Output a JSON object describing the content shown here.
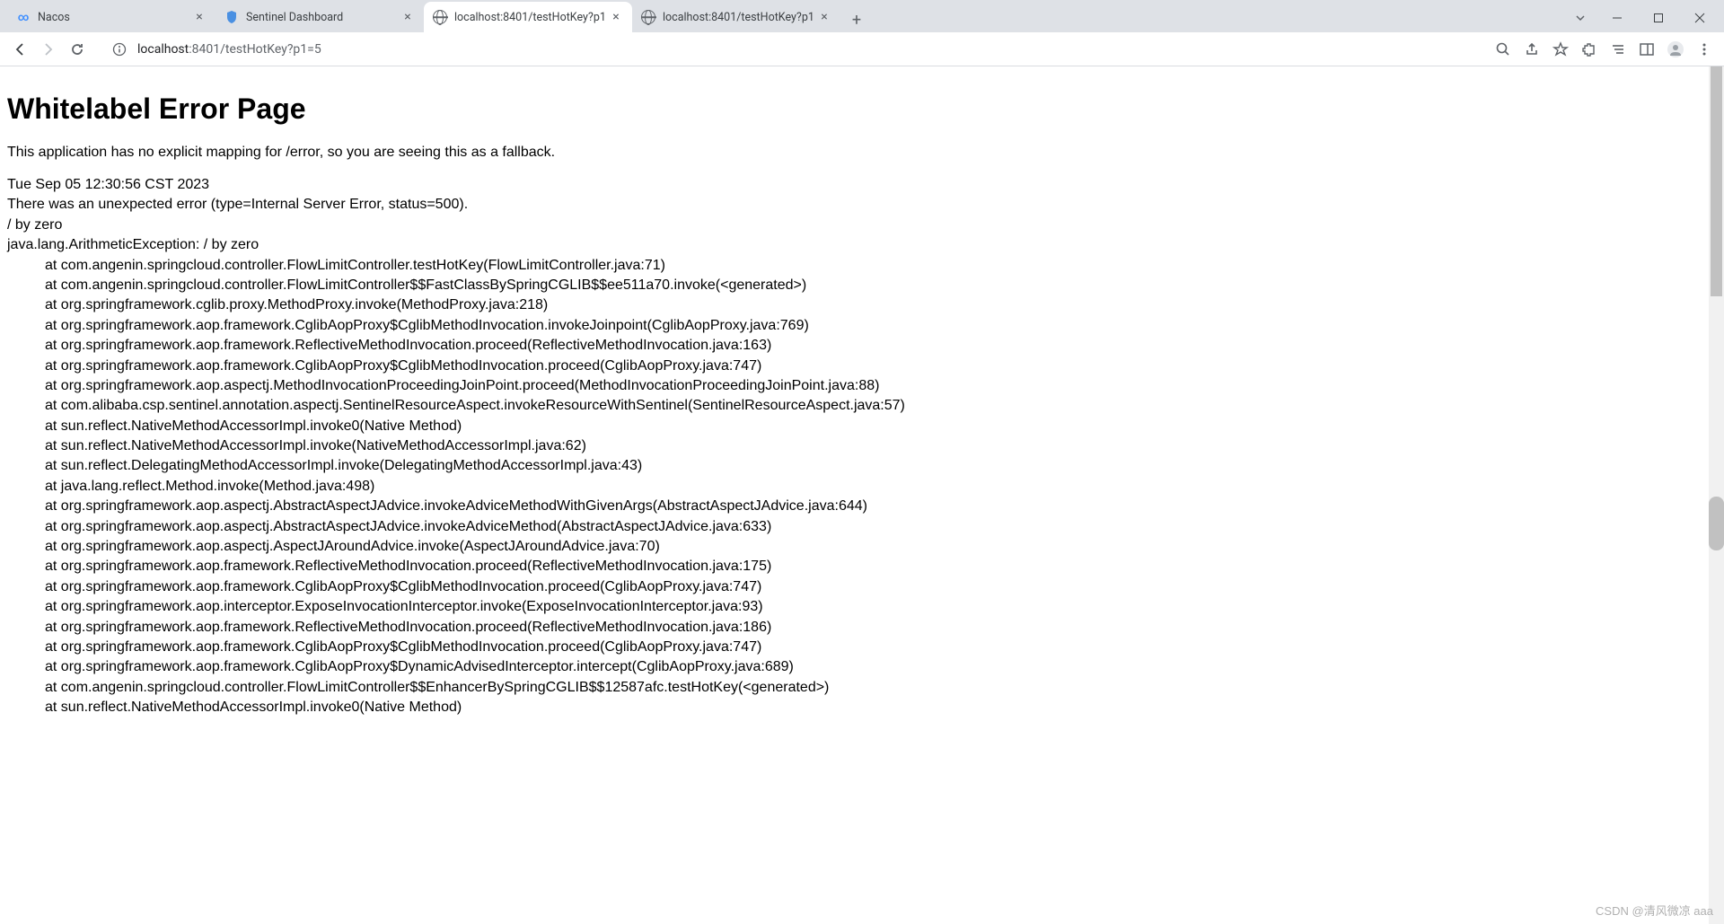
{
  "tabs": [
    {
      "title": "Nacos",
      "favicon": "nacos"
    },
    {
      "title": "Sentinel Dashboard",
      "favicon": "sentinel"
    },
    {
      "title": "localhost:8401/testHotKey?p1",
      "favicon": "globe",
      "active": true
    },
    {
      "title": "localhost:8401/testHotKey?p1",
      "favicon": "globe"
    }
  ],
  "url": {
    "host": "localhost",
    "port_path": ":8401/testHotKey?p1=5"
  },
  "page": {
    "title": "Whitelabel Error Page",
    "subtitle": "This application has no explicit mapping for /error, so you are seeing this as a fallback.",
    "timestamp": "Tue Sep 05 12:30:56 CST 2023",
    "error_line": "There was an unexpected error (type=Internal Server Error, status=500).",
    "message": "/ by zero",
    "exception": "java.lang.ArithmeticException: / by zero",
    "trace": [
      "at com.angenin.springcloud.controller.FlowLimitController.testHotKey(FlowLimitController.java:71)",
      "at com.angenin.springcloud.controller.FlowLimitController$$FastClassBySpringCGLIB$$ee511a70.invoke(<generated>)",
      "at org.springframework.cglib.proxy.MethodProxy.invoke(MethodProxy.java:218)",
      "at org.springframework.aop.framework.CglibAopProxy$CglibMethodInvocation.invokeJoinpoint(CglibAopProxy.java:769)",
      "at org.springframework.aop.framework.ReflectiveMethodInvocation.proceed(ReflectiveMethodInvocation.java:163)",
      "at org.springframework.aop.framework.CglibAopProxy$CglibMethodInvocation.proceed(CglibAopProxy.java:747)",
      "at org.springframework.aop.aspectj.MethodInvocationProceedingJoinPoint.proceed(MethodInvocationProceedingJoinPoint.java:88)",
      "at com.alibaba.csp.sentinel.annotation.aspectj.SentinelResourceAspect.invokeResourceWithSentinel(SentinelResourceAspect.java:57)",
      "at sun.reflect.NativeMethodAccessorImpl.invoke0(Native Method)",
      "at sun.reflect.NativeMethodAccessorImpl.invoke(NativeMethodAccessorImpl.java:62)",
      "at sun.reflect.DelegatingMethodAccessorImpl.invoke(DelegatingMethodAccessorImpl.java:43)",
      "at java.lang.reflect.Method.invoke(Method.java:498)",
      "at org.springframework.aop.aspectj.AbstractAspectJAdvice.invokeAdviceMethodWithGivenArgs(AbstractAspectJAdvice.java:644)",
      "at org.springframework.aop.aspectj.AbstractAspectJAdvice.invokeAdviceMethod(AbstractAspectJAdvice.java:633)",
      "at org.springframework.aop.aspectj.AspectJAroundAdvice.invoke(AspectJAroundAdvice.java:70)",
      "at org.springframework.aop.framework.ReflectiveMethodInvocation.proceed(ReflectiveMethodInvocation.java:175)",
      "at org.springframework.aop.framework.CglibAopProxy$CglibMethodInvocation.proceed(CglibAopProxy.java:747)",
      "at org.springframework.aop.interceptor.ExposeInvocationInterceptor.invoke(ExposeInvocationInterceptor.java:93)",
      "at org.springframework.aop.framework.ReflectiveMethodInvocation.proceed(ReflectiveMethodInvocation.java:186)",
      "at org.springframework.aop.framework.CglibAopProxy$CglibMethodInvocation.proceed(CglibAopProxy.java:747)",
      "at org.springframework.aop.framework.CglibAopProxy$DynamicAdvisedInterceptor.intercept(CglibAopProxy.java:689)",
      "at com.angenin.springcloud.controller.FlowLimitController$$EnhancerBySpringCGLIB$$12587afc.testHotKey(<generated>)",
      "at sun.reflect.NativeMethodAccessorImpl.invoke0(Native Method)"
    ]
  },
  "watermark": "CSDN @清风微凉 aaa"
}
